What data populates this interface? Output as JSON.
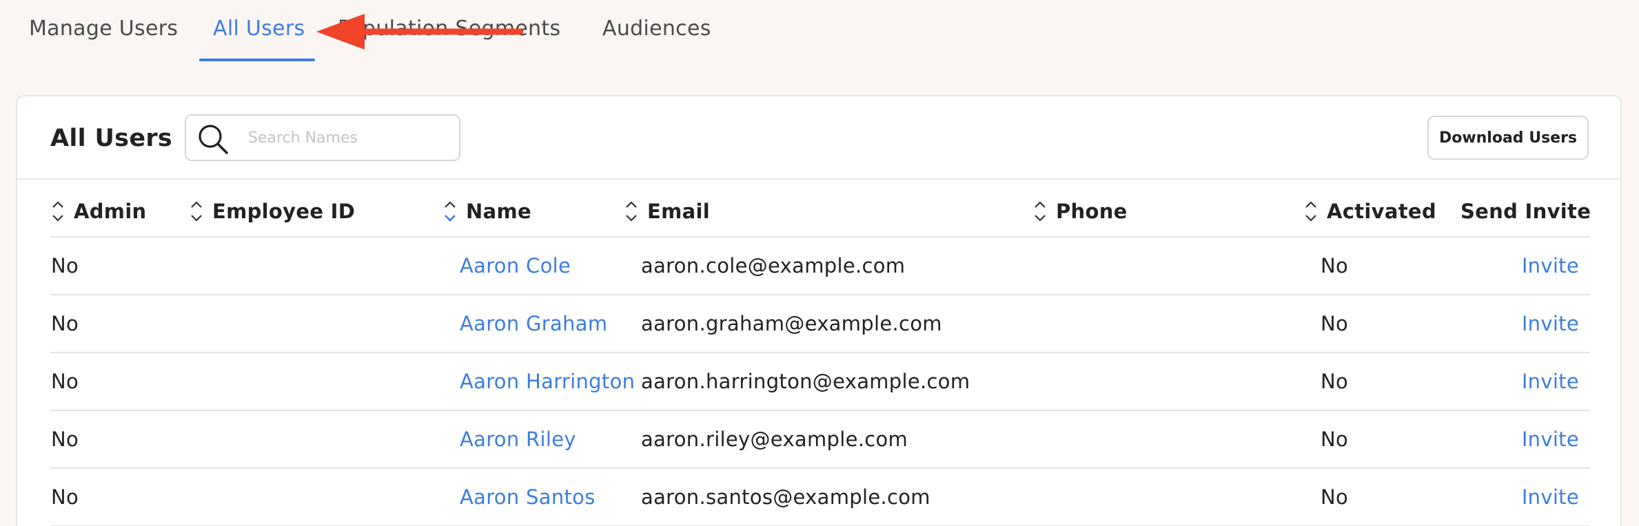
{
  "tabs": [
    {
      "label": "Manage Users",
      "active": false
    },
    {
      "label": "All Users",
      "active": true
    },
    {
      "label": "Population Segments",
      "active": false
    },
    {
      "label": "Audiences",
      "active": false
    }
  ],
  "annotation": {
    "color": "#f0432a"
  },
  "card": {
    "title": "All Users",
    "search": {
      "placeholder": "Search Names",
      "value": ""
    },
    "download_label": "Download Users"
  },
  "table": {
    "columns": [
      {
        "label": "Admin",
        "sortable": true
      },
      {
        "label": "Employee ID",
        "sortable": true
      },
      {
        "label": "Name",
        "sortable": true,
        "sorted": "ascending"
      },
      {
        "label": "Email",
        "sortable": true
      },
      {
        "label": "Phone",
        "sortable": true
      },
      {
        "label": "Activated",
        "sortable": true
      },
      {
        "label": "Send Invite",
        "sortable": false
      }
    ],
    "rows": [
      {
        "admin": "No",
        "employee_id": "",
        "name": "Aaron Cole",
        "email": "aaron.cole@example.com",
        "phone": "",
        "activated": "No",
        "invite": "Invite"
      },
      {
        "admin": "No",
        "employee_id": "",
        "name": "Aaron Graham",
        "email": "aaron.graham@example.com",
        "phone": "",
        "activated": "No",
        "invite": "Invite"
      },
      {
        "admin": "No",
        "employee_id": "",
        "name": "Aaron Harrington",
        "email": "aaron.harrington@example.com",
        "phone": "",
        "activated": "No",
        "invite": "Invite"
      },
      {
        "admin": "No",
        "employee_id": "",
        "name": "Aaron Riley",
        "email": "aaron.riley@example.com",
        "phone": "",
        "activated": "No",
        "invite": "Invite"
      },
      {
        "admin": "No",
        "employee_id": "",
        "name": "Aaron Santos",
        "email": "aaron.santos@example.com",
        "phone": "",
        "activated": "No",
        "invite": "Invite"
      }
    ]
  },
  "colors": {
    "accent": "#3d7de0",
    "background": "#fbf6f4",
    "text": "#222222"
  }
}
